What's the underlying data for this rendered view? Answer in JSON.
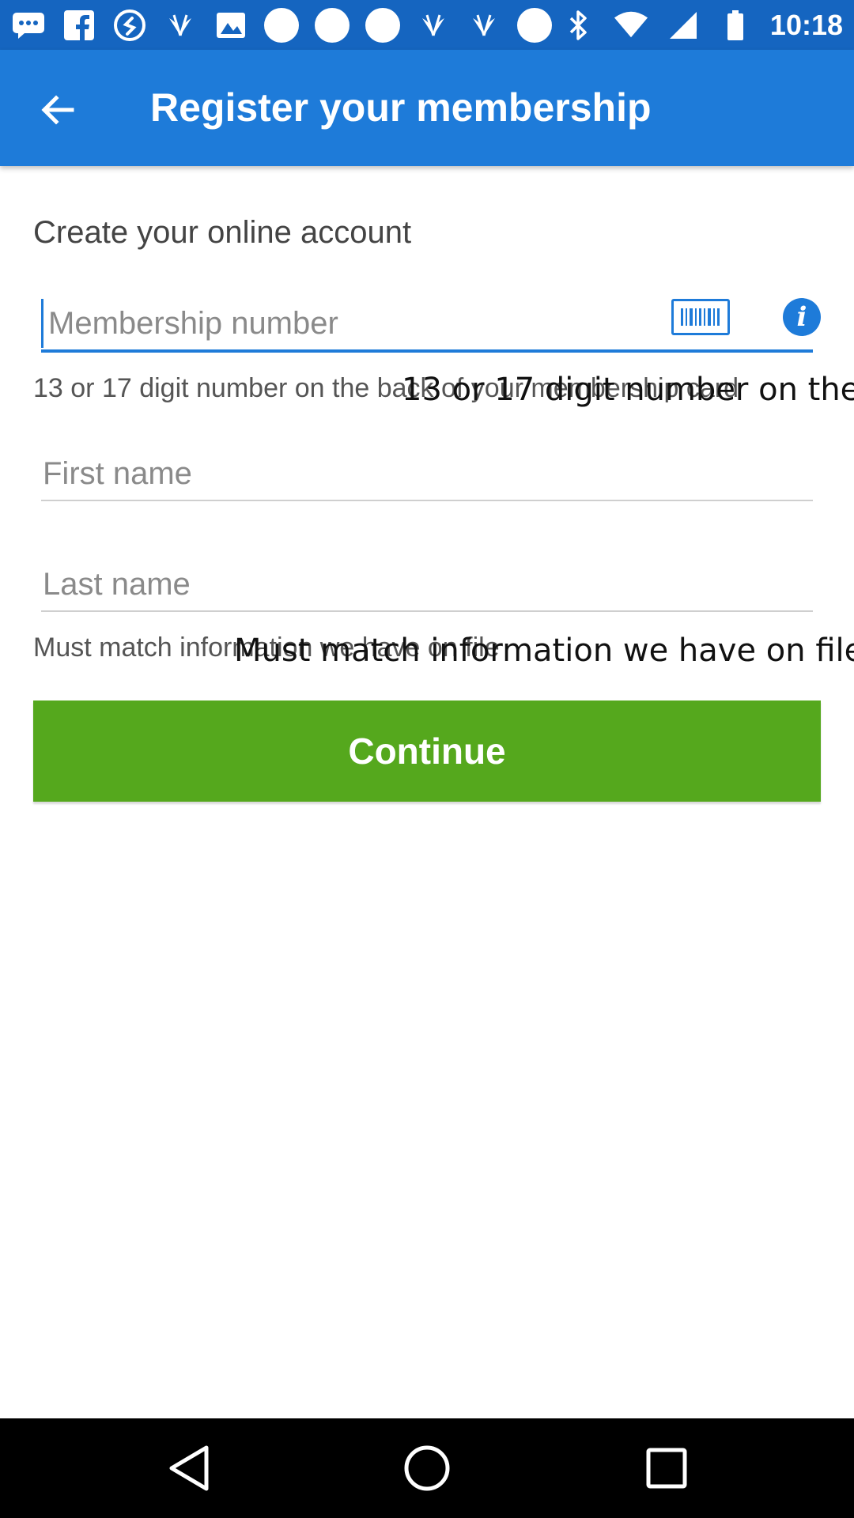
{
  "status_bar": {
    "time": "10:18",
    "left_icons": [
      "message-icon",
      "facebook-icon",
      "shazam-icon",
      "app-icon",
      "gallery-icon",
      "dot-icon",
      "dot-icon",
      "dot-icon",
      "app-icon",
      "app-icon",
      "dot-icon"
    ],
    "right_icons": [
      "bluetooth-icon",
      "wifi-icon",
      "signal-icon",
      "battery-icon"
    ]
  },
  "app_bar": {
    "title": "Register your membership",
    "back_icon": "arrow-back-icon"
  },
  "form": {
    "section_title": "Create your online account",
    "membership": {
      "value": "",
      "placeholder": "Membership number",
      "helper": "13 or 17 digit number on the back of your membership card",
      "helper_overlay": "13 or 17 digit number on the"
    },
    "first_name": {
      "value": "",
      "placeholder": "First name"
    },
    "last_name": {
      "value": "",
      "placeholder": "Last name",
      "helper": "Must match information we have on file",
      "helper_overlay": "Must match information we have on file"
    },
    "barcode_icon": "barcode-icon",
    "info_icon": "info-icon",
    "info_glyph": "i",
    "continue_label": "Continue"
  },
  "colors": {
    "status_bar": "#1565c0",
    "app_bar": "#1e7bd9",
    "accent": "#1e7bd9",
    "continue_button": "#55a81d",
    "nav_bar": "#000000"
  },
  "nav_bar": {
    "icons": [
      "nav-back-icon",
      "nav-home-icon",
      "nav-recents-icon"
    ]
  }
}
